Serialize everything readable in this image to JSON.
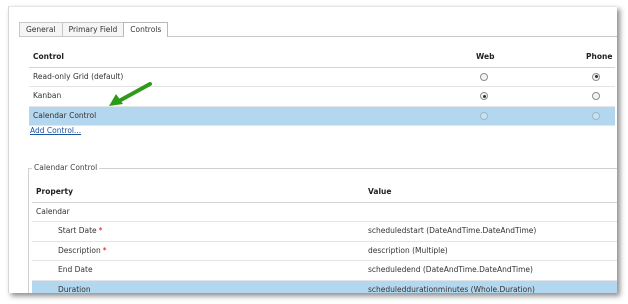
{
  "tabs": [
    {
      "label": "General",
      "active": false
    },
    {
      "label": "Primary Field",
      "active": false
    },
    {
      "label": "Controls",
      "active": true
    }
  ],
  "controls": {
    "headers": {
      "control": "Control",
      "web": "Web",
      "phone": "Phone"
    },
    "rows": [
      {
        "name": "Read-only Grid (default)",
        "web": false,
        "phone": true,
        "selected": false
      },
      {
        "name": "Kanban",
        "web": true,
        "phone": false,
        "selected": false
      },
      {
        "name": "Calendar Control",
        "web": false,
        "phone": false,
        "selected": true
      }
    ],
    "add_label": "Add Control..."
  },
  "calendar": {
    "legend": "Calendar Control",
    "headers": {
      "property": "Property",
      "value": "Value"
    },
    "group": "Calendar",
    "rows": [
      {
        "name": "Start Date",
        "required": "*",
        "value": "scheduledstart (DateAndTime.DateAndTime)",
        "selected": false
      },
      {
        "name": "Description",
        "required": "*",
        "value": "description (Multiple)",
        "selected": false
      },
      {
        "name": "End Date",
        "required": "",
        "value": "scheduledend (DateAndTime.DateAndTime)",
        "selected": false
      },
      {
        "name": "Duration",
        "required": "",
        "value": "scheduleddurationminutes (Whole.Duration)",
        "selected": true
      }
    ]
  },
  "colors": {
    "selected_row": "#b3d7ee",
    "arrow": "#2f9a1a",
    "link": "#1a55a8",
    "required": "#e00000"
  },
  "icons": {
    "annotation": "green-arrow-icon"
  }
}
